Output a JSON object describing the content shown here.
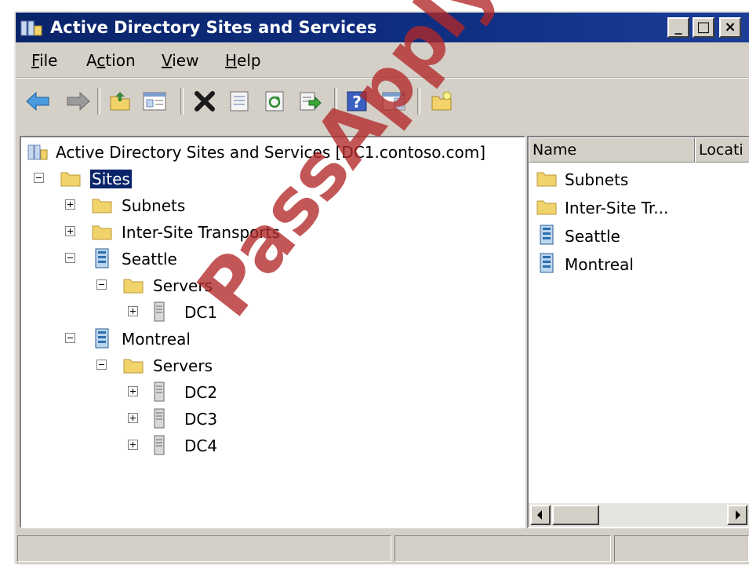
{
  "window": {
    "title": "Active Directory Sites and Services",
    "controls": {
      "minimize": "_",
      "maximize": "□",
      "close": "×"
    }
  },
  "menu": [
    {
      "label": "File",
      "accel": "F",
      "rest": "ile"
    },
    {
      "label": "Action",
      "pre": "A",
      "accel": "c",
      "rest": "tion"
    },
    {
      "label": "View",
      "accel": "V",
      "rest": "iew"
    },
    {
      "label": "Help",
      "accel": "H",
      "rest": "elp"
    }
  ],
  "toolbar": {
    "icons": [
      "back-arrow-icon",
      "forward-arrow-icon",
      "up-folder-icon",
      "show-hide-tree-icon",
      "delete-icon",
      "properties-icon",
      "refresh-icon",
      "export-list-icon",
      "help-icon",
      "action-pane-icon",
      "new-site-icon"
    ]
  },
  "tree": {
    "root": "Active Directory Sites and Services [DC1.contoso.com]",
    "sites": "Sites",
    "subnets": "Subnets",
    "inter_site": "Inter-Site Transports",
    "seattle": "Seattle",
    "seattle_servers": "Servers",
    "dc1": "DC1",
    "montreal": "Montreal",
    "montreal_servers": "Servers",
    "dc2": "DC2",
    "dc3": "DC3",
    "dc4": "DC4"
  },
  "list": {
    "columns": [
      "Name",
      "Locati"
    ],
    "items": [
      "Subnets",
      "Inter-Site Tr...",
      "Seattle",
      "Montreal"
    ]
  },
  "watermark": "PassApply.com",
  "colors": {
    "titlebar": "#0a246a",
    "selection": "#0a246a",
    "watermark": "#b22828"
  }
}
